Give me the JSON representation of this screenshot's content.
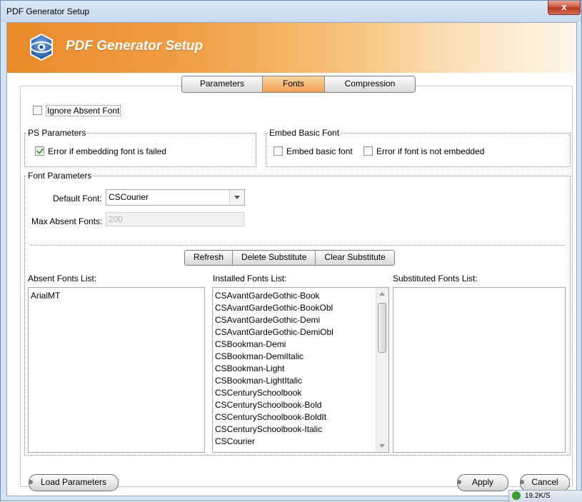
{
  "window": {
    "title": "PDF Generator Setup",
    "close_label": "x"
  },
  "banner": {
    "title": "PDF Generator Setup"
  },
  "tabs": [
    {
      "label": "Parameters",
      "active": false
    },
    {
      "label": "Fonts",
      "active": true
    },
    {
      "label": "Compression",
      "active": false
    }
  ],
  "ignore_absent": {
    "label": "Ignore Absent Font",
    "checked": false
  },
  "ps_params": {
    "title": "PS Parameters",
    "error_embed": {
      "label": "Error if embedding font is failed",
      "checked": true
    }
  },
  "embed_basic": {
    "title": "Embed Basic Font",
    "embed": {
      "label": "Embed basic font",
      "checked": false
    },
    "error_not_embedded": {
      "label": "Error if font is not embedded",
      "checked": false
    }
  },
  "font_params": {
    "title": "Font Parameters",
    "default_font_label": "Default Font:",
    "default_font_value": "CSCourier",
    "max_absent_label": "Max Absent Fonts:",
    "max_absent_value": "200"
  },
  "actions": {
    "refresh": "Refresh",
    "delete_sub": "Delete Substitute",
    "clear_sub": "Clear Substitute"
  },
  "lists": {
    "absent_label": "Absent Fonts List:",
    "installed_label": "Installed Fonts List:",
    "substituted_label": "Substituted Fonts List:",
    "absent": [
      "ArialMT"
    ],
    "installed": [
      "CSAvantGardeGothic-Book",
      "CSAvantGardeGothic-BookObl",
      "CSAvantGardeGothic-Demi",
      "CSAvantGardeGothic-DemiObl",
      "CSBookman-Demi",
      "CSBookman-DemiItalic",
      "CSBookman-Light",
      "CSBookman-LightItalic",
      "CSCenturySchoolbook",
      "CSCenturySchoolbook-Bold",
      "CSCenturySchoolbook-BoldIt",
      "CSCenturySchoolbook-Italic",
      "CSCourier"
    ],
    "substituted": []
  },
  "footer": {
    "load": "Load Parameters",
    "apply": "Apply",
    "cancel": "Cancel"
  },
  "tray": {
    "text": "19.2K/S"
  },
  "colors": {
    "accent_orange": "#f0a050",
    "check_green": "#3f9a32"
  }
}
